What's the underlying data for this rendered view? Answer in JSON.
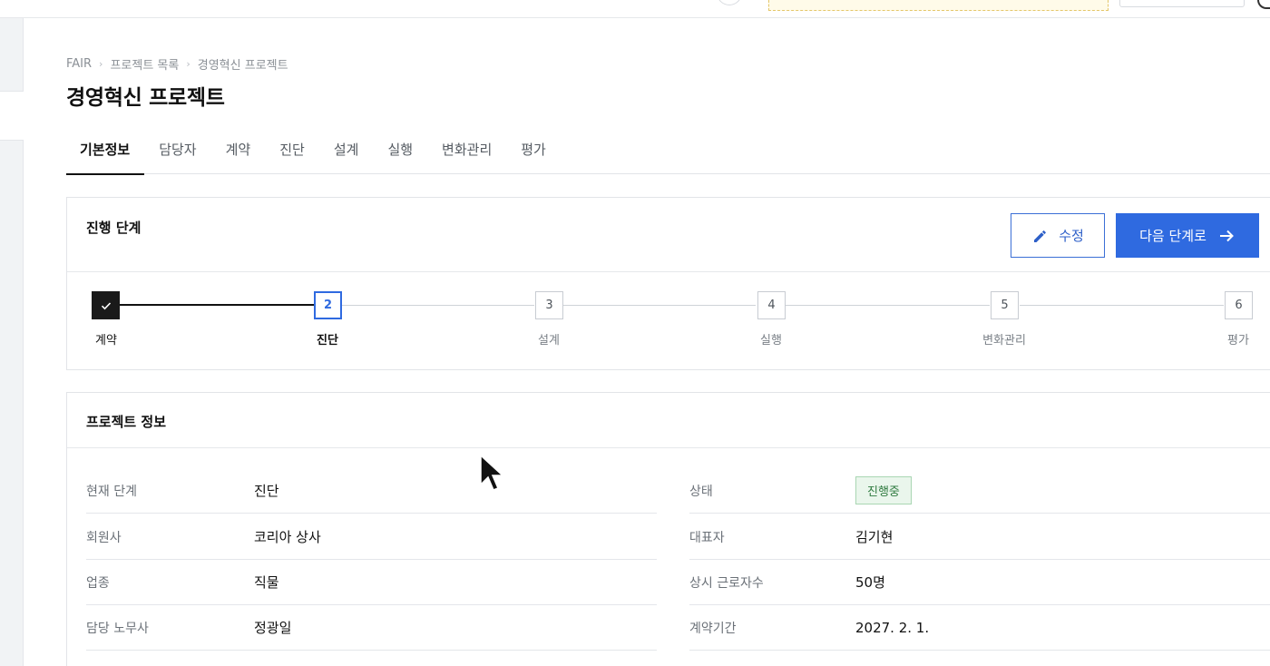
{
  "breadcrumb": [
    "FAIR",
    "프로젝트 목록",
    "경영혁신 프로젝트"
  ],
  "page_title": "경영혁신 프로젝트",
  "tabs": [
    "기본정보",
    "담당자",
    "계약",
    "진단",
    "설계",
    "실행",
    "변화관리",
    "평가"
  ],
  "active_tab": 0,
  "stage_card": {
    "title": "진행 단계",
    "edit_label": "수정",
    "next_label": "다음 단계로",
    "steps": [
      {
        "num": "",
        "label": "계약",
        "state": "done"
      },
      {
        "num": "2",
        "label": "진단",
        "state": "current"
      },
      {
        "num": "3",
        "label": "설계",
        "state": "pending"
      },
      {
        "num": "4",
        "label": "실행",
        "state": "pending"
      },
      {
        "num": "5",
        "label": "변화관리",
        "state": "pending"
      },
      {
        "num": "6",
        "label": "평가",
        "state": "pending"
      }
    ]
  },
  "info_card": {
    "title": "프로젝트 정보",
    "left": [
      {
        "label": "현재 단계",
        "value": "진단"
      },
      {
        "label": "회원사",
        "value": "코리아 상사"
      },
      {
        "label": "업종",
        "value": "직물"
      },
      {
        "label": "담당 노무사",
        "value": "정광일"
      }
    ],
    "right": [
      {
        "label": "상태",
        "value": "진행중",
        "badge": true
      },
      {
        "label": "대표자",
        "value": "김기현"
      },
      {
        "label": "상시 근로자수",
        "value": "50명"
      },
      {
        "label": "계약기간",
        "value": "2027. 2. 1."
      }
    ],
    "badge_color": "#2f7a3f"
  },
  "colors": {
    "primary": "#2f6ae0",
    "done": "#1a1a1a"
  }
}
